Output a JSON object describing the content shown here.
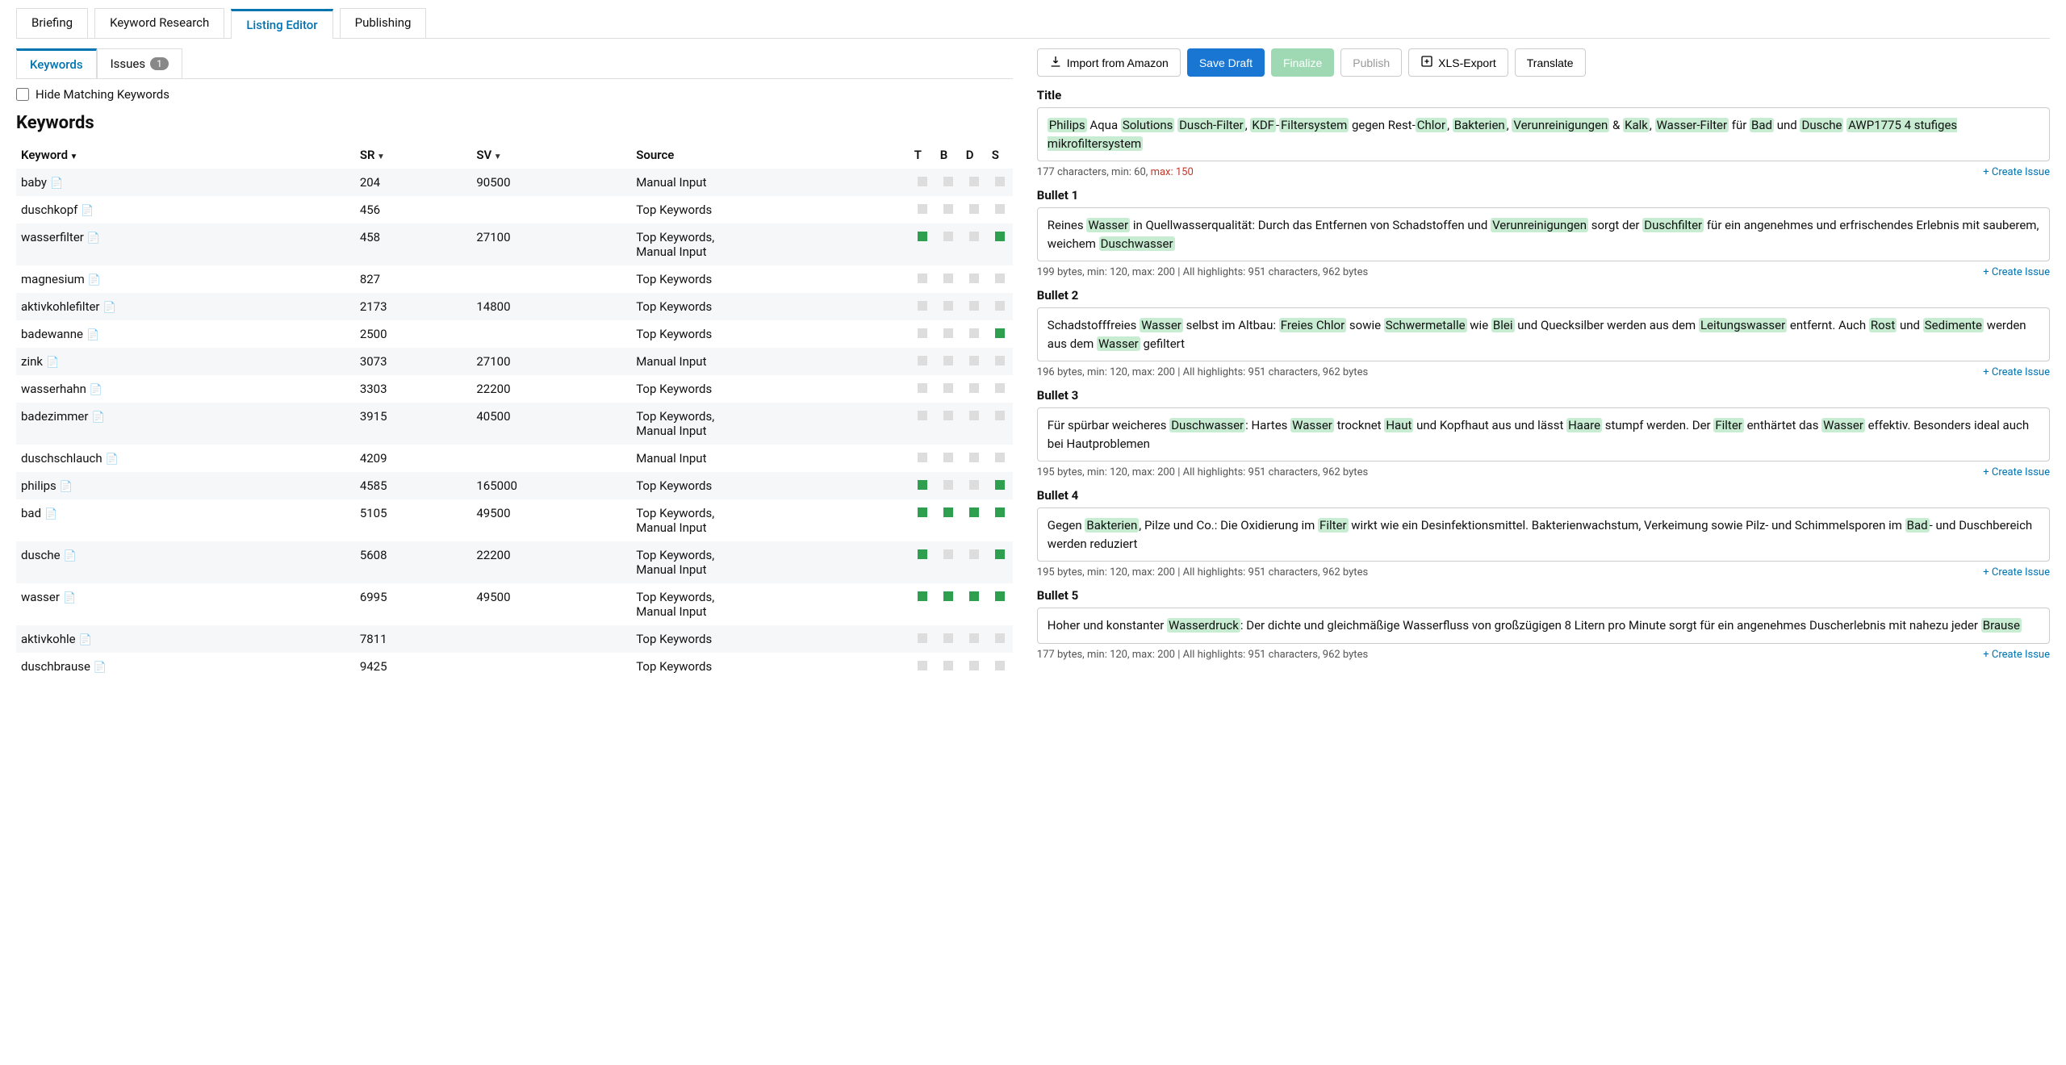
{
  "mainTabs": [
    "Briefing",
    "Keyword Research",
    "Listing Editor",
    "Publishing"
  ],
  "mainActive": 2,
  "subTabs": {
    "keywords": "Keywords",
    "issues": "Issues",
    "issuesCount": "1"
  },
  "hideMatching": "Hide Matching Keywords",
  "kwHeading": "Keywords",
  "columns": {
    "keyword": "Keyword",
    "sr": "SR",
    "sv": "SV",
    "source": "Source",
    "t": "T",
    "b": "B",
    "d": "D",
    "s": "S"
  },
  "rows": [
    {
      "k": "baby",
      "sr": "204",
      "sv": "90500",
      "src": "Manual Input",
      "f": [
        0,
        0,
        0,
        0
      ]
    },
    {
      "k": "duschkopf",
      "sr": "456",
      "sv": "",
      "src": "Top Keywords",
      "f": [
        0,
        0,
        0,
        0
      ]
    },
    {
      "k": "wasserfilter",
      "sr": "458",
      "sv": "27100",
      "src": "Top Keywords, Manual Input",
      "f": [
        1,
        0,
        0,
        1
      ]
    },
    {
      "k": "magnesium",
      "sr": "827",
      "sv": "",
      "src": "Top Keywords",
      "f": [
        0,
        0,
        0,
        0
      ]
    },
    {
      "k": "aktivkohlefilter",
      "sr": "2173",
      "sv": "14800",
      "src": "Top Keywords",
      "f": [
        0,
        0,
        0,
        0
      ]
    },
    {
      "k": "badewanne",
      "sr": "2500",
      "sv": "",
      "src": "Top Keywords",
      "f": [
        0,
        0,
        0,
        1
      ]
    },
    {
      "k": "zink",
      "sr": "3073",
      "sv": "27100",
      "src": "Manual Input",
      "f": [
        0,
        0,
        0,
        0
      ]
    },
    {
      "k": "wasserhahn",
      "sr": "3303",
      "sv": "22200",
      "src": "Top Keywords",
      "f": [
        0,
        0,
        0,
        0
      ]
    },
    {
      "k": "badezimmer",
      "sr": "3915",
      "sv": "40500",
      "src": "Top Keywords, Manual Input",
      "f": [
        0,
        0,
        0,
        0
      ]
    },
    {
      "k": "duschschlauch",
      "sr": "4209",
      "sv": "",
      "src": "Manual Input",
      "f": [
        0,
        0,
        0,
        0
      ]
    },
    {
      "k": "philips",
      "sr": "4585",
      "sv": "165000",
      "src": "Top Keywords",
      "f": [
        1,
        0,
        0,
        1
      ]
    },
    {
      "k": "bad",
      "sr": "5105",
      "sv": "49500",
      "src": "Top Keywords, Manual Input",
      "f": [
        1,
        1,
        1,
        1
      ]
    },
    {
      "k": "dusche",
      "sr": "5608",
      "sv": "22200",
      "src": "Top Keywords, Manual Input",
      "f": [
        1,
        0,
        0,
        1
      ]
    },
    {
      "k": "wasser",
      "sr": "6995",
      "sv": "49500",
      "src": "Top Keywords, Manual Input",
      "f": [
        1,
        1,
        1,
        1
      ]
    },
    {
      "k": "aktivkohle",
      "sr": "7811",
      "sv": "",
      "src": "Top Keywords",
      "f": [
        0,
        0,
        0,
        0
      ]
    },
    {
      "k": "duschbrause",
      "sr": "9425",
      "sv": "",
      "src": "Top Keywords",
      "f": [
        0,
        0,
        0,
        0
      ]
    }
  ],
  "actions": {
    "import": "Import from Amazon",
    "save": "Save Draft",
    "finalize": "Finalize",
    "publish": "Publish",
    "xls": "XLS-Export",
    "translate": "Translate"
  },
  "createIssue": "+ Create Issue",
  "fields": {
    "title": {
      "label": "Title",
      "segments": [
        [
          "Philips",
          1
        ],
        [
          " Aqua ",
          0
        ],
        [
          "Solutions",
          1
        ],
        [
          " ",
          0
        ],
        [
          "Dusch-Filter",
          1
        ],
        [
          ", ",
          0
        ],
        [
          "KDF",
          1
        ],
        [
          "-",
          0
        ],
        [
          "Filtersystem",
          1
        ],
        [
          " gegen Rest-",
          0
        ],
        [
          "Chlor",
          1
        ],
        [
          ", ",
          0
        ],
        [
          "Bakterien",
          1
        ],
        [
          ", ",
          0
        ],
        [
          "Verunreinigungen",
          1
        ],
        [
          " & ",
          0
        ],
        [
          "Kalk",
          1
        ],
        [
          ", ",
          0
        ],
        [
          "Wasser-Filter",
          1
        ],
        [
          " für ",
          0
        ],
        [
          "Bad",
          1
        ],
        [
          " und ",
          0
        ],
        [
          "Dusche",
          1
        ],
        [
          " ",
          0
        ],
        [
          "AWP1775 4 stufiges mikrofiltersystem",
          1
        ]
      ],
      "meta_pre": "177 characters, min: 60, ",
      "meta_warn": "max: 150"
    },
    "b1": {
      "label": "Bullet 1",
      "segments": [
        [
          "Reines ",
          0
        ],
        [
          "Wasser",
          1
        ],
        [
          " in Quellwasserqualität: Durch das Entfernen von Schadstoffen und ",
          0
        ],
        [
          "Verunreinigungen",
          1
        ],
        [
          " sorgt der ",
          0
        ],
        [
          "Duschfilter",
          1
        ],
        [
          " für ein angenehmes und erfrischendes Erlebnis mit sauberem, weichem ",
          0
        ],
        [
          "Duschwasser",
          1
        ]
      ],
      "meta": "199 bytes, min: 120, max: 200 | All highlights: 951 characters, 962 bytes"
    },
    "b2": {
      "label": "Bullet 2",
      "segments": [
        [
          "Schadstofffreies ",
          0
        ],
        [
          "Wasser",
          1
        ],
        [
          " selbst im Altbau: ",
          0
        ],
        [
          "Freies Chlor",
          1
        ],
        [
          " sowie ",
          0
        ],
        [
          "Schwermetalle",
          1
        ],
        [
          " wie ",
          0
        ],
        [
          "Blei",
          1
        ],
        [
          " und Quecksilber werden aus dem ",
          0
        ],
        [
          "Leitungswasser",
          1
        ],
        [
          " entfernt. Auch ",
          0
        ],
        [
          "Rost",
          1
        ],
        [
          " und ",
          0
        ],
        [
          "Sedimente",
          1
        ],
        [
          " werden aus dem ",
          0
        ],
        [
          "Wasser",
          1
        ],
        [
          " gefiltert",
          0
        ]
      ],
      "meta": "196 bytes, min: 120, max: 200 | All highlights: 951 characters, 962 bytes"
    },
    "b3": {
      "label": "Bullet 3",
      "segments": [
        [
          "Für spürbar weicheres ",
          0
        ],
        [
          "Duschwasser",
          1
        ],
        [
          ": Hartes ",
          0
        ],
        [
          "Wasser",
          1
        ],
        [
          " trocknet ",
          0
        ],
        [
          "Haut",
          1
        ],
        [
          " und Kopfhaut aus und lässt ",
          0
        ],
        [
          "Haare",
          1
        ],
        [
          " stumpf werden. Der ",
          0
        ],
        [
          "Filter",
          1
        ],
        [
          " enthärtet das ",
          0
        ],
        [
          "Wasser",
          1
        ],
        [
          " effektiv. Besonders ideal auch bei Hautproblemen",
          0
        ]
      ],
      "meta": "195 bytes, min: 120, max: 200 | All highlights: 951 characters, 962 bytes"
    },
    "b4": {
      "label": "Bullet 4",
      "segments": [
        [
          "Gegen ",
          0
        ],
        [
          "Bakterien",
          1
        ],
        [
          ", Pilze und Co.: Die Oxidierung im ",
          0
        ],
        [
          "Filter",
          1
        ],
        [
          " wirkt wie ein Desinfektionsmittel. Bakterienwachstum, Verkeimung sowie Pilz- und Schimmelsporen im ",
          0
        ],
        [
          "Bad",
          1
        ],
        [
          "- und Duschbereich werden reduziert",
          0
        ]
      ],
      "meta": "195 bytes, min: 120, max: 200 | All highlights: 951 characters, 962 bytes"
    },
    "b5": {
      "label": "Bullet 5",
      "segments": [
        [
          "Hoher und konstanter ",
          0
        ],
        [
          "Wasserdruck",
          1
        ],
        [
          ": Der dichte und gleichmäßige Wasserfluss von großzügigen 8 Litern pro Minute sorgt für ein angenehmes Duscherlebnis mit nahezu jeder ",
          0
        ],
        [
          "Brause",
          1
        ]
      ],
      "meta": "177 bytes, min: 120, max: 200 | All highlights: 951 characters, 962 bytes"
    }
  }
}
